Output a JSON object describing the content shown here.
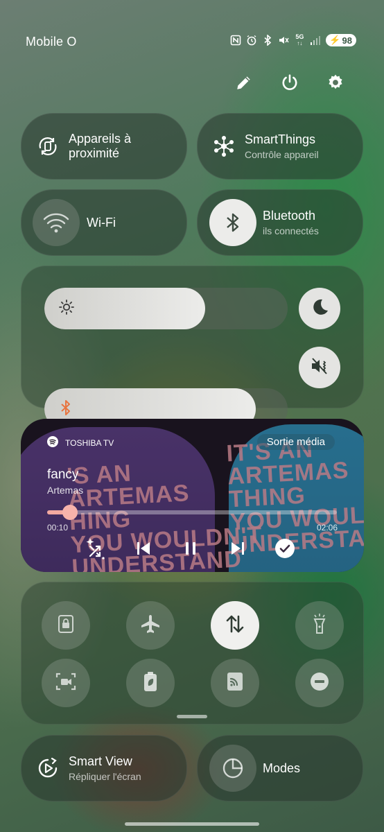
{
  "status_bar": {
    "carrier": "Mobile O",
    "icons": [
      "nfc-icon",
      "alarm-icon",
      "bluetooth-icon",
      "mute-icon",
      "5g-icon",
      "signal-icon"
    ],
    "network": "5G",
    "battery": "98"
  },
  "top_actions": [
    "edit-icon",
    "power-icon",
    "settings-icon"
  ],
  "tiles": {
    "nearby": {
      "title_line1": "Appareils à",
      "title_line2": "proximité"
    },
    "smartthings": {
      "title": "SmartThings",
      "subtitle": "Contrôle appareil"
    },
    "wifi": {
      "title": "Wi-Fi",
      "active": false
    },
    "bluetooth": {
      "title": "Bluetooth",
      "subtitle": "ils connectés",
      "active": true
    }
  },
  "sliders": {
    "brightness": {
      "level": 0.66,
      "icon": "brightness-icon"
    },
    "volume": {
      "level": 0.87,
      "icon": "bluetooth-audio-icon",
      "accent": "#e8743f"
    }
  },
  "media": {
    "source": "TOSHIBA TV",
    "output_label": "Sortie média",
    "title": "fancy",
    "artist": "Artemas",
    "elapsed": "00:10",
    "duration": "02:06",
    "progress": 0.08,
    "accent": "#f3a9a0",
    "art_text_left": [
      "'S AN",
      "ARTEMAS",
      "HING",
      "YOU WOULDN'T",
      "UNDERSTAND"
    ],
    "art_text_right": [
      "IT'S AN",
      "ARTEMAS",
      "THING",
      "YOU WOULD",
      "UNDERSTAND"
    ]
  },
  "quick_toggles": [
    {
      "name": "secure-folder-icon",
      "on": false
    },
    {
      "name": "airplane-icon",
      "on": false
    },
    {
      "name": "mobile-data-icon",
      "on": true
    },
    {
      "name": "flashlight-icon",
      "on": false
    },
    {
      "name": "screen-recorder-icon",
      "on": false
    },
    {
      "name": "power-saving-icon",
      "on": false
    },
    {
      "name": "cast-icon",
      "on": false
    },
    {
      "name": "do-not-disturb-icon",
      "on": false
    }
  ],
  "bottom_tiles": {
    "smart_view": {
      "title": "Smart View",
      "subtitle": "Répliquer l'écran"
    },
    "modes": {
      "title": "Modes"
    }
  }
}
